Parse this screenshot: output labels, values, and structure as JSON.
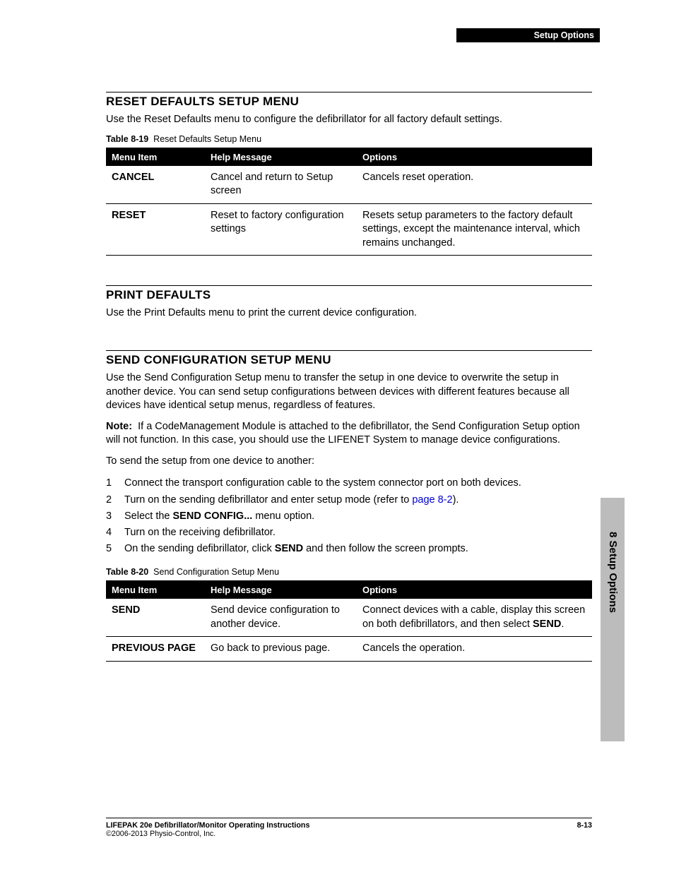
{
  "header_tag": "Setup Options",
  "side_tab": "8 Setup Options",
  "sections": {
    "reset": {
      "title": "RESET DEFAULTS SETUP MENU",
      "desc": "Use the Reset Defaults menu to configure the defibrillator for all factory default settings.",
      "caption_num": "Table 8-19",
      "caption_txt": "Reset Defaults Setup Menu",
      "cols": {
        "c1": "Menu Item",
        "c2": "Help Message",
        "c3": "Options"
      },
      "rows": [
        {
          "mi": "CANCEL",
          "hm": "Cancel and return to Setup screen",
          "op": "Cancels reset operation."
        },
        {
          "mi": "RESET",
          "hm": "Reset to factory configuration settings",
          "op": "Resets setup parameters to the factory default settings, except the maintenance interval, which remains unchanged."
        }
      ]
    },
    "print": {
      "title": "PRINT DEFAULTS",
      "desc": "Use the Print Defaults menu to print the current device configuration."
    },
    "send": {
      "title": "SEND CONFIGURATION SETUP MENU",
      "p1": "Use the Send Configuration Setup menu to transfer the setup in one device to overwrite the setup in another device. You can send setup configurations between devices with different features because all devices have identical setup menus, regardless of features.",
      "note_label": "Note:",
      "note": "If a CodeManagement Module is attached to the defibrillator, the Send Configuration Setup option will not function. In this case, you should use the LIFENET System to manage device configurations.",
      "p3": "To send the setup from one device to another:",
      "steps": {
        "s1": "Connect the transport configuration cable to the system connector port on both devices.",
        "s2a": "Turn on the sending defibrillator and enter setup mode (refer to ",
        "s2link": "page 8-2",
        "s2b": ").",
        "s3a": "Select the ",
        "s3b": "SEND CONFIG...",
        "s3c": " menu option.",
        "s4": "Turn on the receiving defibrillator.",
        "s5a": "On the sending defibrillator, click ",
        "s5b": "SEND",
        "s5c": " and then follow the screen prompts."
      },
      "caption_num": "Table 8-20",
      "caption_txt": "Send Configuration Setup Menu",
      "cols": {
        "c1": "Menu Item",
        "c2": "Help Message",
        "c3": "Options"
      },
      "rows": {
        "r1": {
          "mi": "SEND",
          "hm": "Send device configuration to another device.",
          "op_a": "Connect devices with a cable, display this screen on both defibrillators, and then select ",
          "op_b": "SEND",
          "op_c": "."
        },
        "r2": {
          "mi": "PREVIOUS PAGE",
          "hm": "Go back to previous page.",
          "op": "Cancels the operation."
        }
      }
    }
  },
  "footer": {
    "title": "LIFEPAK 20e Defibrillator/Monitor Operating Instructions",
    "copyright": "©2006-2013 Physio-Control, Inc.",
    "page": "8-13"
  }
}
